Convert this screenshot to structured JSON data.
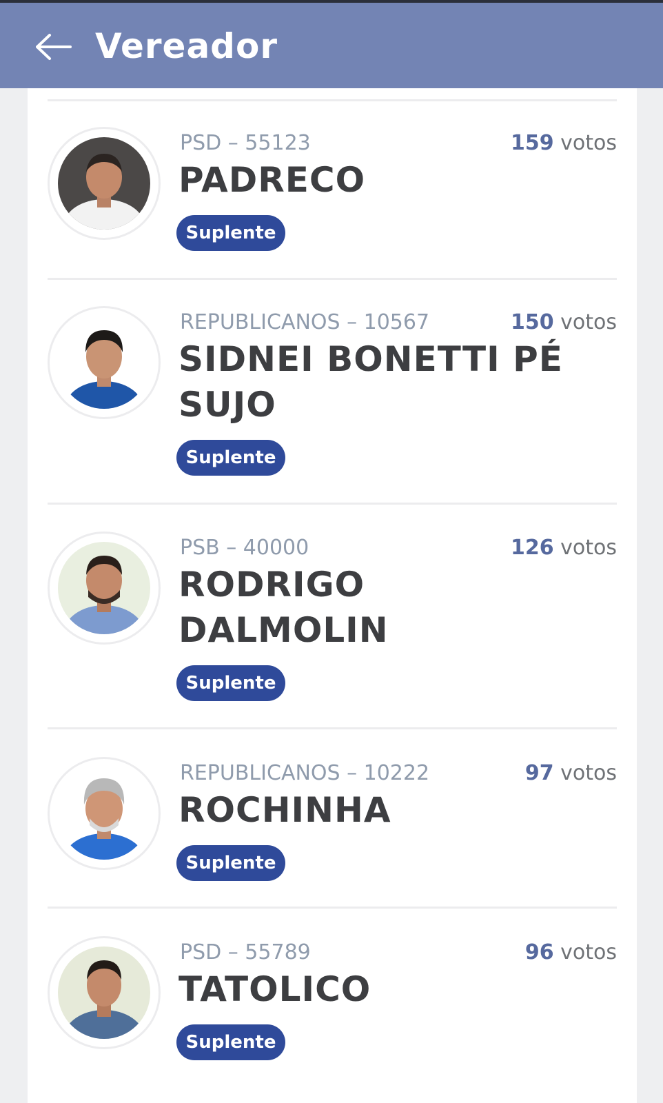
{
  "header": {
    "title": "Vereador",
    "back_icon": "arrow-left-icon",
    "color": "#7384b4"
  },
  "candidates": [
    {
      "party": "PSD – 55123",
      "name": "PADRECO",
      "votes": "159",
      "votes_label": "votos",
      "status": "Suplente",
      "shirt_color": "#f2f2f2",
      "hair_color": "#2b2421",
      "bg": "#4b4847"
    },
    {
      "party": "REPUBLICANOS – 10567",
      "name": "SIDNEI BONETTI PÉ SUJO",
      "votes": "150",
      "votes_label": "votos",
      "status": "Suplente",
      "shirt_color": "#1f56a8",
      "hair_color": "#1d1a18",
      "bg": "#ffffff"
    },
    {
      "party": "PSB – 40000",
      "name": "RODRIGO DALMOLIN",
      "votes": "126",
      "votes_label": "votos",
      "status": "Suplente",
      "shirt_color": "#7d9bcf",
      "hair_color": "#2a1f1a",
      "bg": "#e9efe0"
    },
    {
      "party": "REPUBLICANOS – 10222",
      "name": "ROCHINHA",
      "votes": "97",
      "votes_label": "votos",
      "status": "Suplente",
      "shirt_color": "#2c6fd1",
      "hair_color": "#b8b8b8",
      "bg": "#ffffff"
    },
    {
      "party": "PSD – 55789",
      "name": "TATOLICO",
      "votes": "96",
      "votes_label": "votos",
      "status": "Suplente",
      "shirt_color": "#4f6f99",
      "hair_color": "#231b17",
      "bg": "#e6ead9"
    }
  ],
  "colors": {
    "badge": "#2f4a9a",
    "votes_number": "#56699e",
    "party_text": "#8f9bac",
    "name_text": "#3d3e41"
  }
}
